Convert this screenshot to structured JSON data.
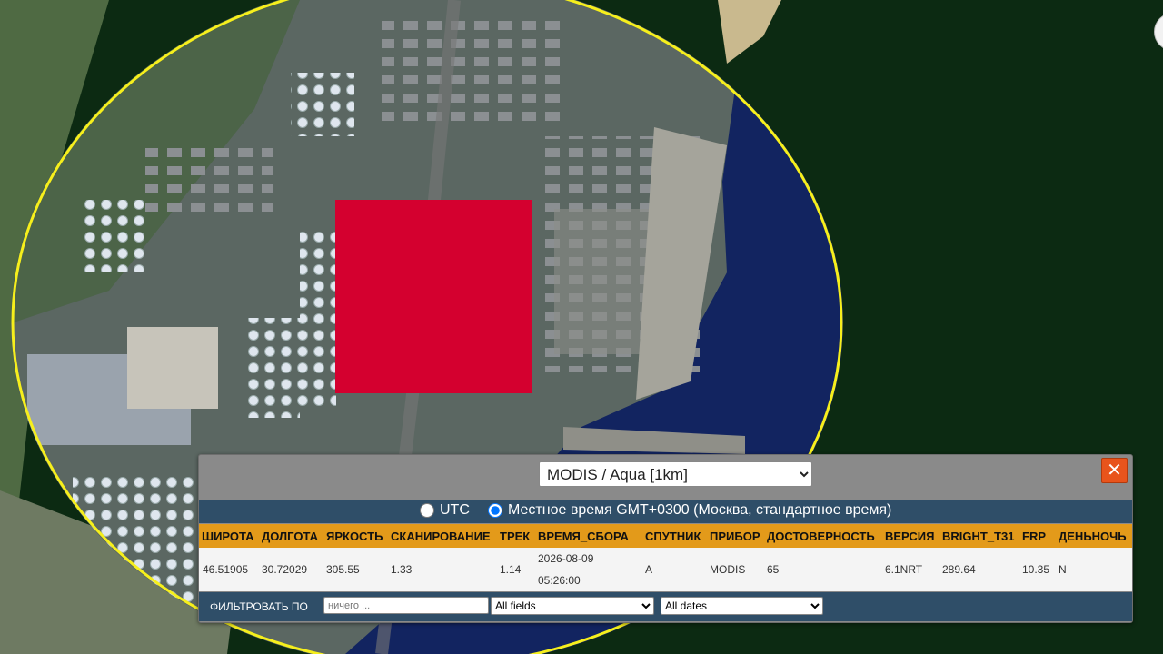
{
  "map": {
    "colors": {
      "water_near": "#14265e",
      "water_far": "#0d2d14",
      "land": "#586a55",
      "aoi_circle": "#ffff00",
      "fire_marker": "#d4002f"
    }
  },
  "popup": {
    "source_select": {
      "value": "MODIS / Aqua [1km]",
      "options": [
        "MODIS / Aqua [1km]"
      ]
    },
    "close_label": "✕",
    "time_options": [
      {
        "label": "UTC",
        "checked": false
      },
      {
        "label": "Местное время GMT+0300 (Москва, стандартное время)",
        "checked": true
      }
    ],
    "columns": [
      "ШИРОТА",
      "ДОЛГОТА",
      "ЯРКОСТЬ",
      "СКАНИРОВАНИЕ",
      "ТРЕК",
      "ВРЕМЯ_СБОРА",
      "СПУТНИК",
      "ПРИБОР",
      "ДОСТОВЕРНОСТЬ",
      "ВЕРСИЯ",
      "BRIGHT_T31",
      "FRP",
      "ДЕНЬНОЧЬ"
    ],
    "row": {
      "lat": "46.51905",
      "lon": "30.72029",
      "brightness": "305.55",
      "scan": "1.33",
      "track": "1.14",
      "acq_date": "2026-08-09",
      "acq_time": "05:26:00",
      "satellite": "A",
      "instrument": "MODIS",
      "confidence": "65",
      "version": "6.1NRT",
      "bright_t31": "289.64",
      "frp": "10.35",
      "daynight": "N"
    },
    "filter": {
      "label": "ФИЛЬТРОВАТЬ ПО",
      "placeholder": "ничего ...",
      "field_select": "All fields",
      "date_select": "All dates"
    }
  }
}
